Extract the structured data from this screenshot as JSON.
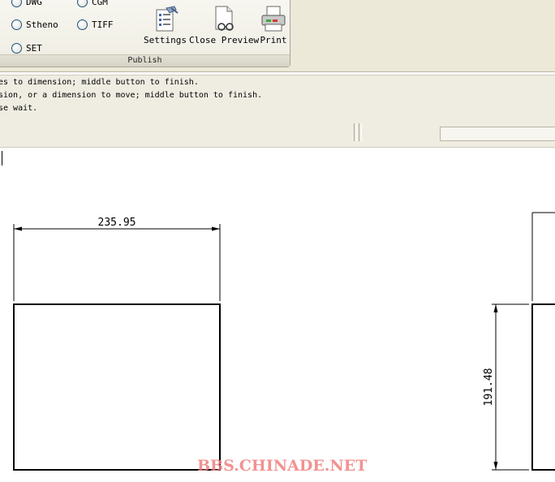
{
  "publish_group": {
    "label": "Publish",
    "formats": [
      {
        "id": "dwg",
        "label": "DWG"
      },
      {
        "id": "cgm",
        "label": "CGM"
      },
      {
        "id": "stheno",
        "label": "Stheno"
      },
      {
        "id": "tiff",
        "label": "TIFF"
      },
      {
        "id": "set",
        "label": "SET"
      }
    ],
    "tools": [
      {
        "id": "settings",
        "label": "Settings",
        "icon": "settings-icon"
      },
      {
        "id": "close-preview",
        "label": "Close Preview",
        "icon": "close-preview-icon"
      },
      {
        "id": "print",
        "label": "Print",
        "icon": "print-icon"
      }
    ]
  },
  "messages": [
    "es to dimension; middle button to finish.",
    "sion, or a dimension to move; middle button to finish.",
    "se wait."
  ],
  "drawing": {
    "horizontal_dimension": "235.95",
    "vertical_dimension": "191.48"
  },
  "watermark": "BBS.CHINADE.NET"
}
